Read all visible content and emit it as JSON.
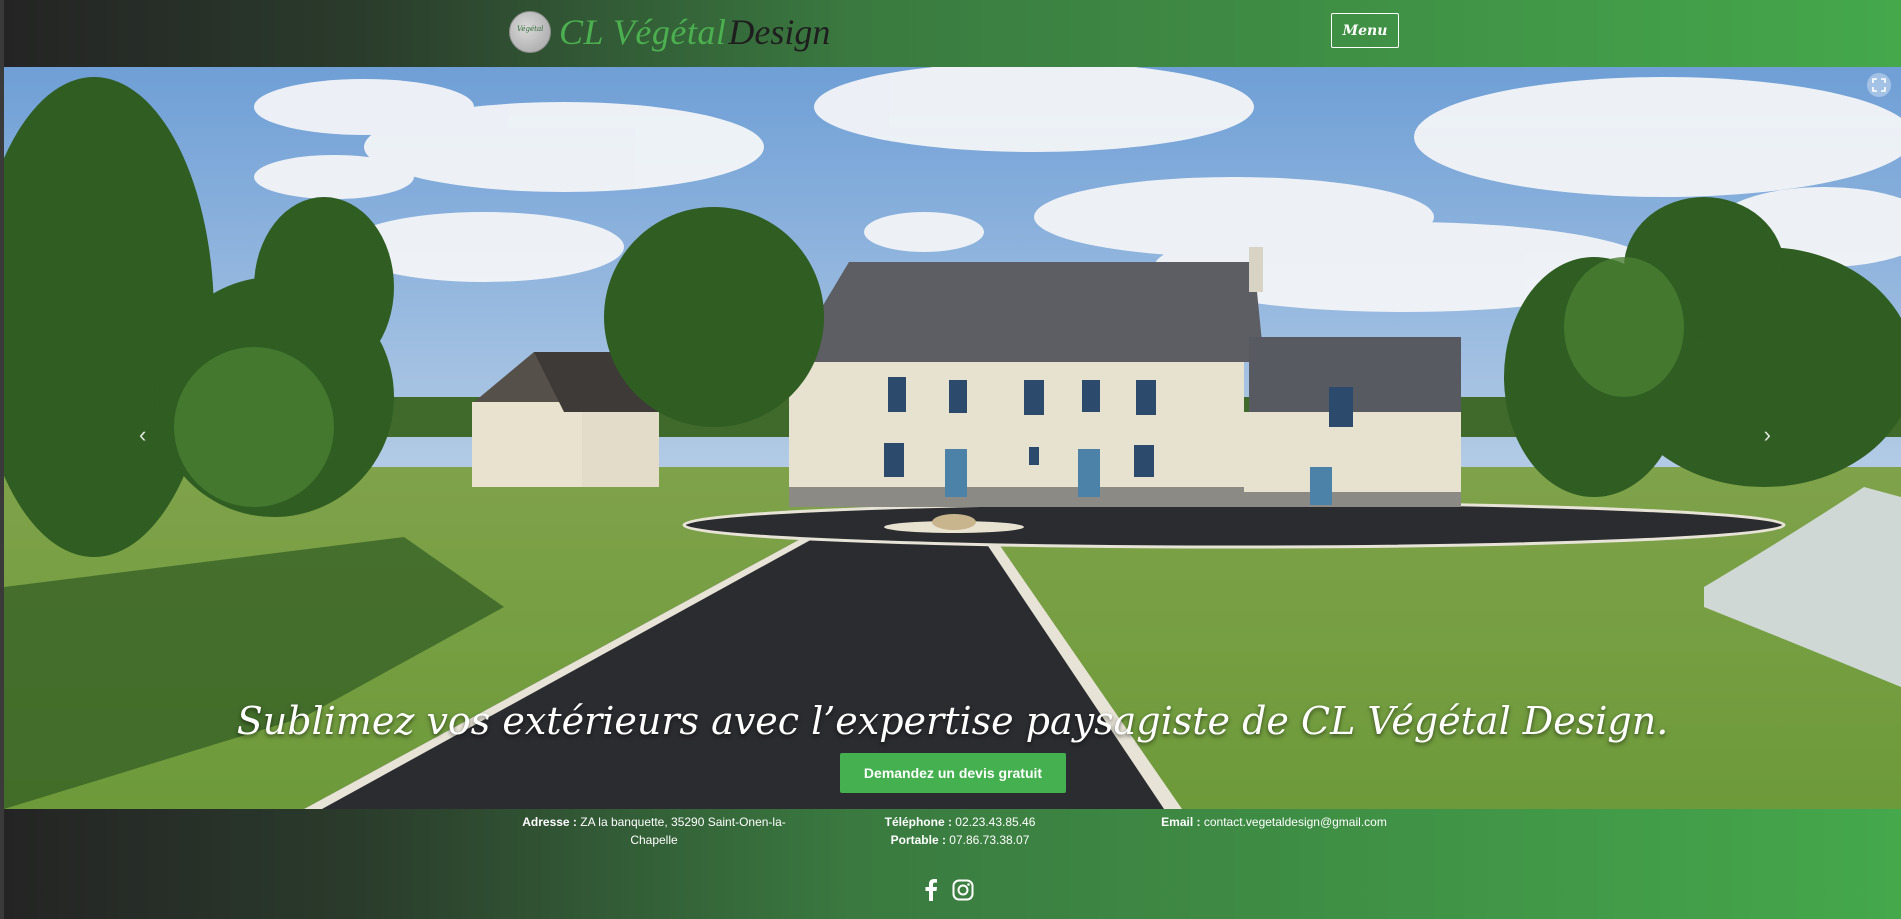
{
  "header": {
    "logo_badge_text": "Végétal",
    "logo_text_green": "CL Végétal",
    "logo_text_dark": "Design",
    "menu_label": "Menu"
  },
  "hero": {
    "tagline": "Sublimez vos extérieurs avec l’expertise paysagiste de CL Végétal Design.",
    "cta_label": "Demandez un devis gratuit",
    "prev_arrow": "‹",
    "next_arrow": "›"
  },
  "footer": {
    "address_label": "Adresse :",
    "address_value": "ZA la banquette, 35290 Saint-Onen-la-Chapelle",
    "phone_label": "Téléphone :",
    "phone_value": "02.23.43.85.46",
    "mobile_label": "Portable :",
    "mobile_value": "07.86.73.38.07",
    "email_label": "Email :",
    "email_value": "contact.vegetaldesign@gmail.com"
  },
  "icons": [
    "expand-icon",
    "facebook-icon",
    "instagram-icon"
  ],
  "colors": {
    "brand_green": "#4caf50",
    "cta_green": "#45b04f",
    "header_dark": "#242424"
  }
}
